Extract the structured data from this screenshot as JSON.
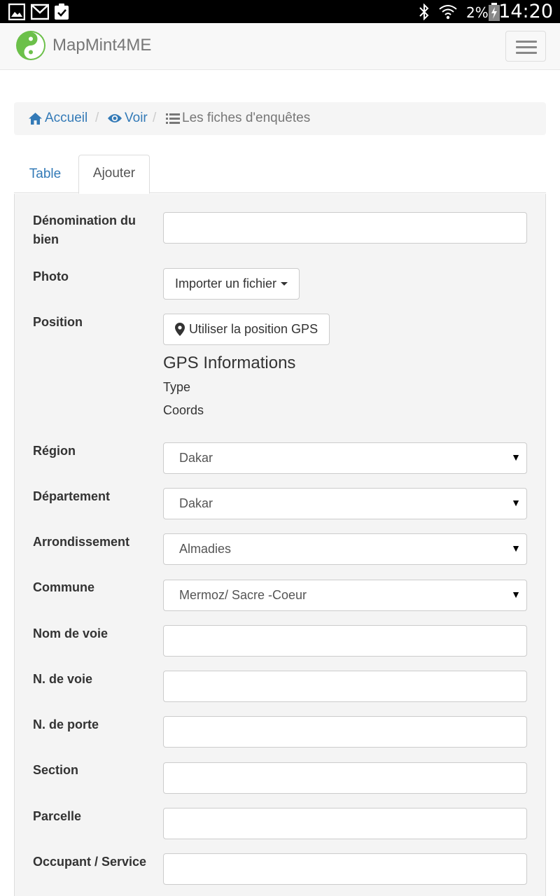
{
  "status_bar": {
    "battery": "2%",
    "time": "14:20"
  },
  "navbar": {
    "brand": "MapMint4ME"
  },
  "breadcrumb": {
    "items": [
      {
        "label": "Accueil",
        "icon": "home-icon"
      },
      {
        "label": "Voir",
        "icon": "eye-icon"
      },
      {
        "label": "Les fiches d'enquêtes",
        "icon": "list-icon"
      }
    ],
    "separator": "/"
  },
  "tabs": [
    {
      "label": "Table",
      "active": false
    },
    {
      "label": "Ajouter",
      "active": true
    }
  ],
  "form": {
    "denomination_label": "Dénomination du bien",
    "denomination_value": "",
    "photo_label": "Photo",
    "photo_button": "Importer un fichier",
    "position_label": "Position",
    "gps_button": "Utiliser la position GPS",
    "gps_title": "GPS Informations",
    "gps_type": "Type",
    "gps_coords": "Coords",
    "region_label": "Région",
    "region_value": "Dakar",
    "departement_label": "Département",
    "departement_value": "Dakar",
    "arrondissement_label": "Arrondissement",
    "arrondissement_value": "Almadies",
    "commune_label": "Commune",
    "commune_value": "Mermoz/ Sacre -Coeur",
    "nom_voie_label": "Nom de voie",
    "n_voie_label": "N. de voie",
    "n_porte_label": "N. de porte",
    "section_label": "Section",
    "parcelle_label": "Parcelle",
    "occupant_label": "Occupant / Service"
  },
  "colors": {
    "link": "#337ab7",
    "brand_green": "#6cc04a",
    "panel_bg": "#f4f4f4"
  }
}
